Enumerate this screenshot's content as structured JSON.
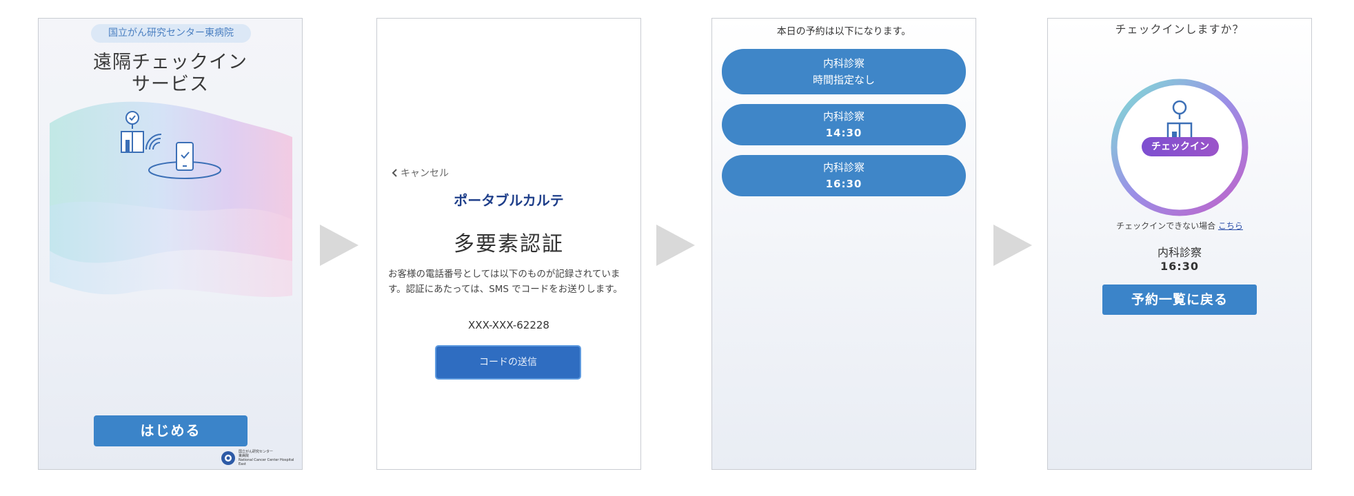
{
  "screen1": {
    "hospital_pill": "国立がん研究センター東病院",
    "title_line1": "遠隔チェックイン",
    "title_line2": "サービス",
    "start_button": "はじめる",
    "logo_text_line1": "国立がん研究センター",
    "logo_text_line2": "東病院",
    "logo_text_line3": "National Cancer Center Hospital East",
    "illustration": [
      "location-pin-icon",
      "building-icon",
      "wifi-icon",
      "smartphone-check-icon"
    ]
  },
  "screen2": {
    "cancel_label": "キャンセル",
    "brand": "ポータブルカルテ",
    "heading": "多要素認証",
    "description": "お客様の電話番号としては以下のものが記録されています。認証にあたっては、SMS でコードをお送りします。",
    "phone_number": "XXX-XXX-62228",
    "send_button": "コードの送信"
  },
  "screen3": {
    "header": "本日の予約は以下になります。",
    "appointments": [
      {
        "department": "内科診察",
        "time": "時間指定なし"
      },
      {
        "department": "内科診察",
        "time": "14:30"
      },
      {
        "department": "内科診察",
        "time": "16:30"
      }
    ]
  },
  "screen4": {
    "question": "チェックインしますか？",
    "checkin_badge": "チェックイン",
    "help_text": "チェックインできない場合",
    "help_link": "こちら",
    "department": "内科診察",
    "time": "16:30",
    "back_button": "予約一覧に戻る"
  },
  "colors": {
    "primary_blue": "#3b84c9",
    "brand_navy": "#1f3f8a",
    "checkin_purple": "#7d4fd0",
    "arrow_gray": "#d9d9d9"
  }
}
